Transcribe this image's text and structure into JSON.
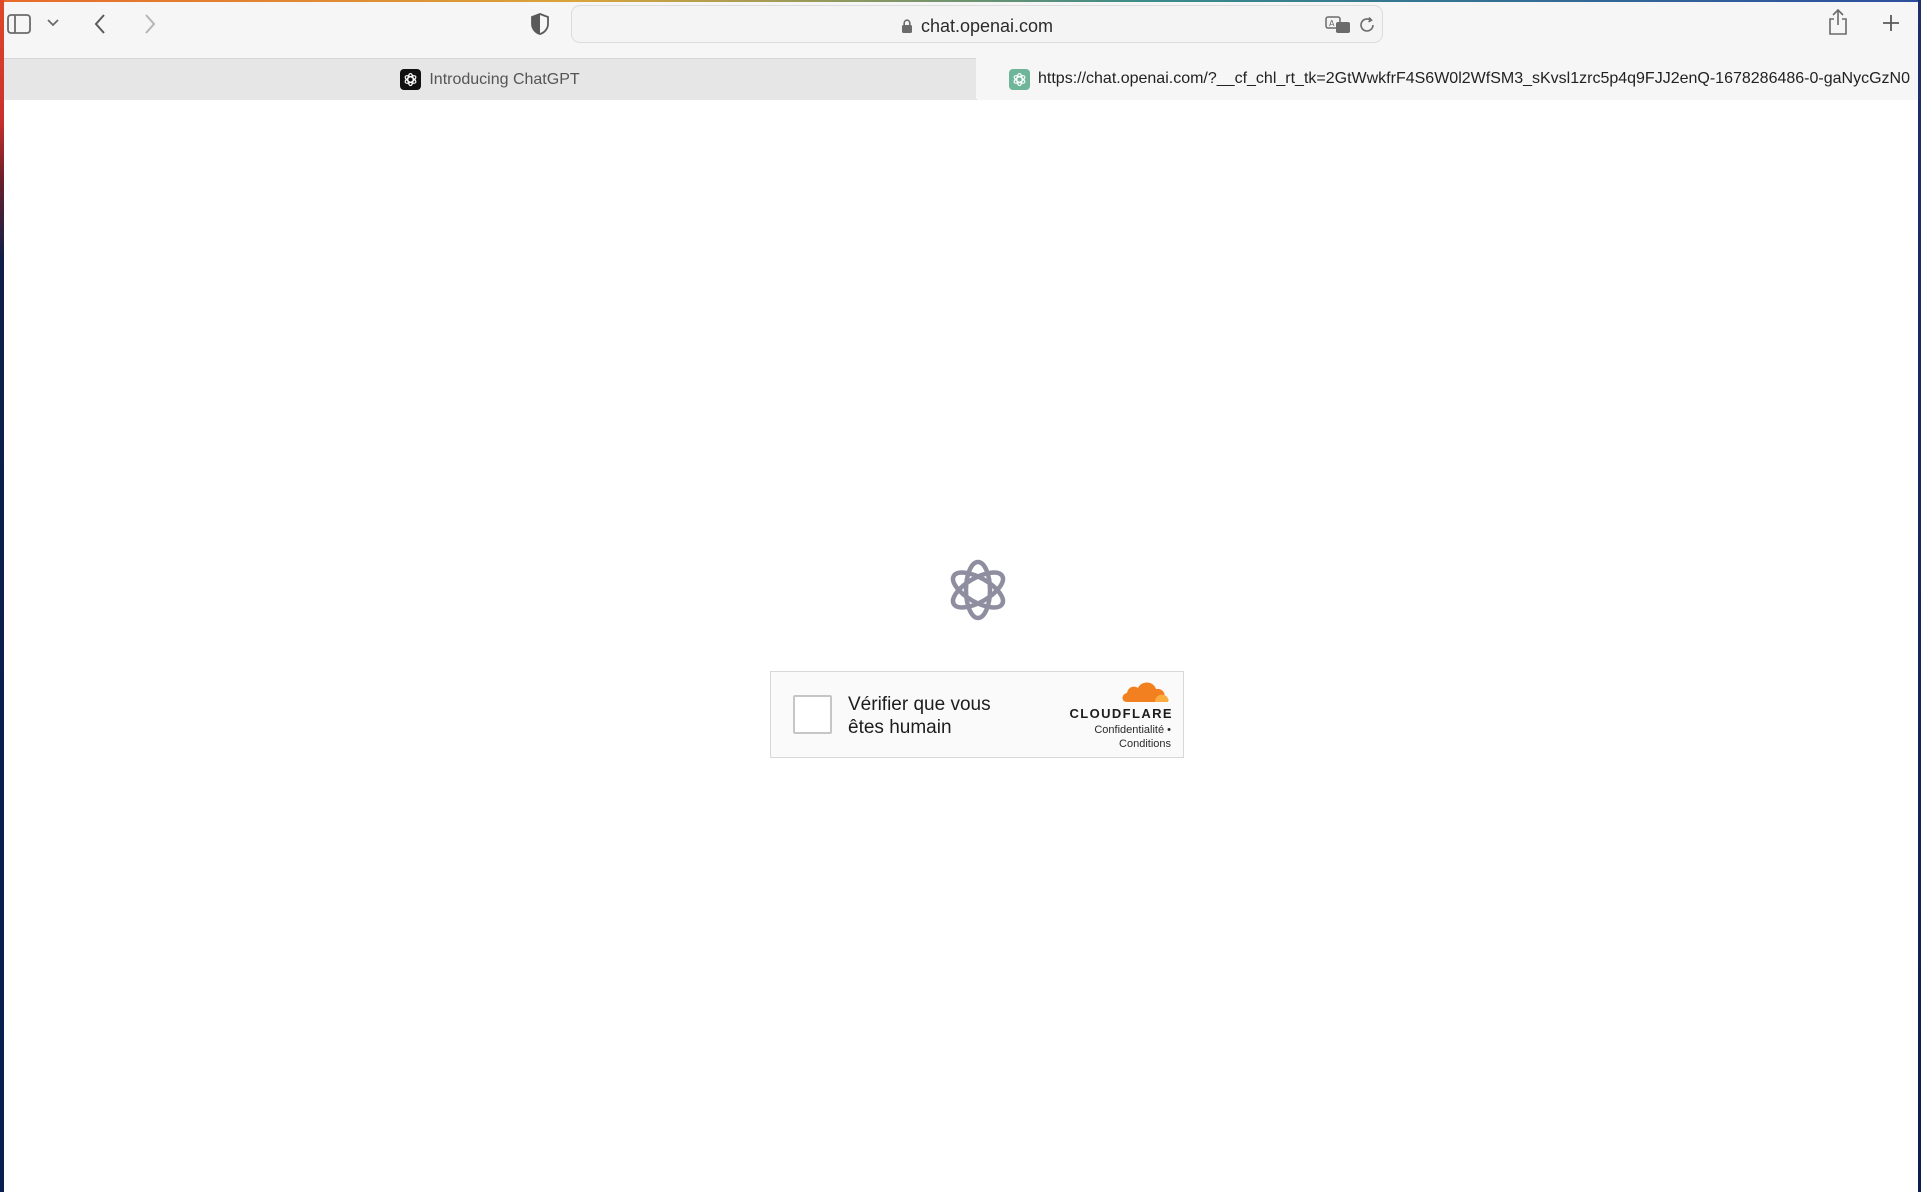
{
  "browser": {
    "address_bar": {
      "url_display": "chat.openai.com"
    },
    "tabs": [
      {
        "title": "Introducing ChatGPT",
        "active": false
      },
      {
        "title": "https://chat.openai.com/?__cf_chl_rt_tk=2GtWwkfrF4S6W0l2WfSM3_sKvsl1zrc5p4q9FJJ2enQ-1678286486-0-gaNycGzN0",
        "active": true
      }
    ],
    "icons": [
      "sidebar-icon",
      "chevron-down-icon",
      "back-icon",
      "forward-icon",
      "privacy-shield-icon",
      "lock-icon",
      "translate-icon",
      "reload-icon",
      "share-icon",
      "new-tab-icon"
    ]
  },
  "page": {
    "logo": "openai-logo-icon",
    "challenge": {
      "checkbox_label": "Vérifier que vous êtes humain",
      "brand": "CLOUDFLARE",
      "privacy_link": "Confidentialité",
      "separator": "•",
      "terms_link": "Conditions"
    }
  },
  "colors": {
    "cloudflare_orange": "#f38020",
    "logo_gray": "#8e8ea0",
    "tab_favicon_green": "#6fb59a"
  }
}
